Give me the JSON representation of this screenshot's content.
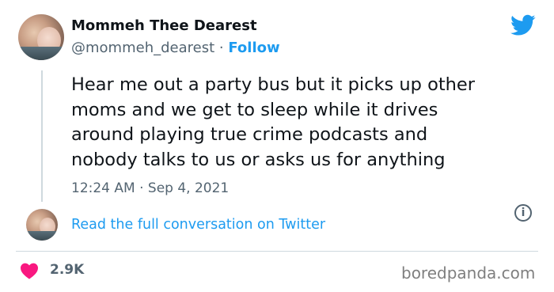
{
  "author": {
    "display_name": "Mommeh Thee Dearest",
    "handle": "@mommeh_dearest",
    "separator": "·",
    "follow_label": "Follow"
  },
  "tweet": {
    "lines": [
      "Hear me out a party bus but it picks up other",
      "moms and we get to sleep while it drives",
      "around playing true crime podcasts and",
      "nobody talks to us or asks us for anything"
    ],
    "timestamp": "12:24 AM · Sep 4, 2021"
  },
  "conversation_link": "Read the full conversation on Twitter",
  "likes": "2.9K",
  "watermark": "boredpanda.com",
  "icons": {
    "brand": "twitter-bird-icon",
    "info": "info-icon",
    "like": "heart-icon"
  },
  "colors": {
    "accent": "#1d9bf0",
    "heart": "#f91880",
    "secondary_text": "#536471"
  }
}
